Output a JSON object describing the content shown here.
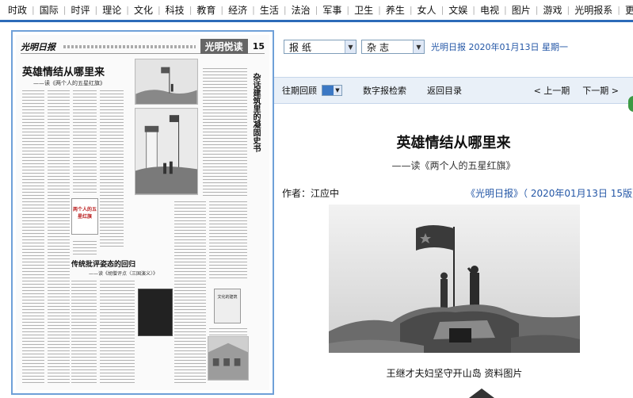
{
  "nav": {
    "items": [
      "时政",
      "国际",
      "时评",
      "理论",
      "文化",
      "科技",
      "教育",
      "经济",
      "生活",
      "法治",
      "军事",
      "卫生",
      "养生",
      "女人",
      "文娱",
      "电视",
      "图片",
      "游戏",
      "光明报系",
      "更多>>"
    ]
  },
  "paper": {
    "logo": "光明日报",
    "section": "光明悦读",
    "page_number": "15",
    "title": "英雄情结从哪里来",
    "subtitle": "——读《两个人的五星红旗》",
    "book_title": "两个人的五星红旗",
    "title2": "传统批评姿态的回归",
    "subtitle2": "——读《胡僧评点〈三国演义〉》",
    "vertical_title": "杂话建筑里的凝固史书",
    "book2_title": "文化的建筑"
  },
  "selectors": {
    "paper": "报纸",
    "magazine": "杂志",
    "date_info": "光明日报 2020年01月13日 星期一"
  },
  "toolbar": {
    "past_review": "往期回顾",
    "digital_search": "数字报检索",
    "back_to_toc": "返回目录",
    "prev": "< 上一期",
    "next": "下一期 >"
  },
  "article": {
    "title": "英雄情结从哪里来",
    "subtitle": "——读《两个人的五星红旗》",
    "author": "作者：江应中",
    "source": "《光明日报》（ 2020年01月13日 15版）",
    "caption": "王继才夫妇坚守开山岛 资料图片"
  },
  "colors": {
    "nav_border": "#2c6bb8",
    "link_blue": "#2356a6",
    "toolbar_bg": "#e9f0f8",
    "frame_blue": "#6fa0d8"
  }
}
